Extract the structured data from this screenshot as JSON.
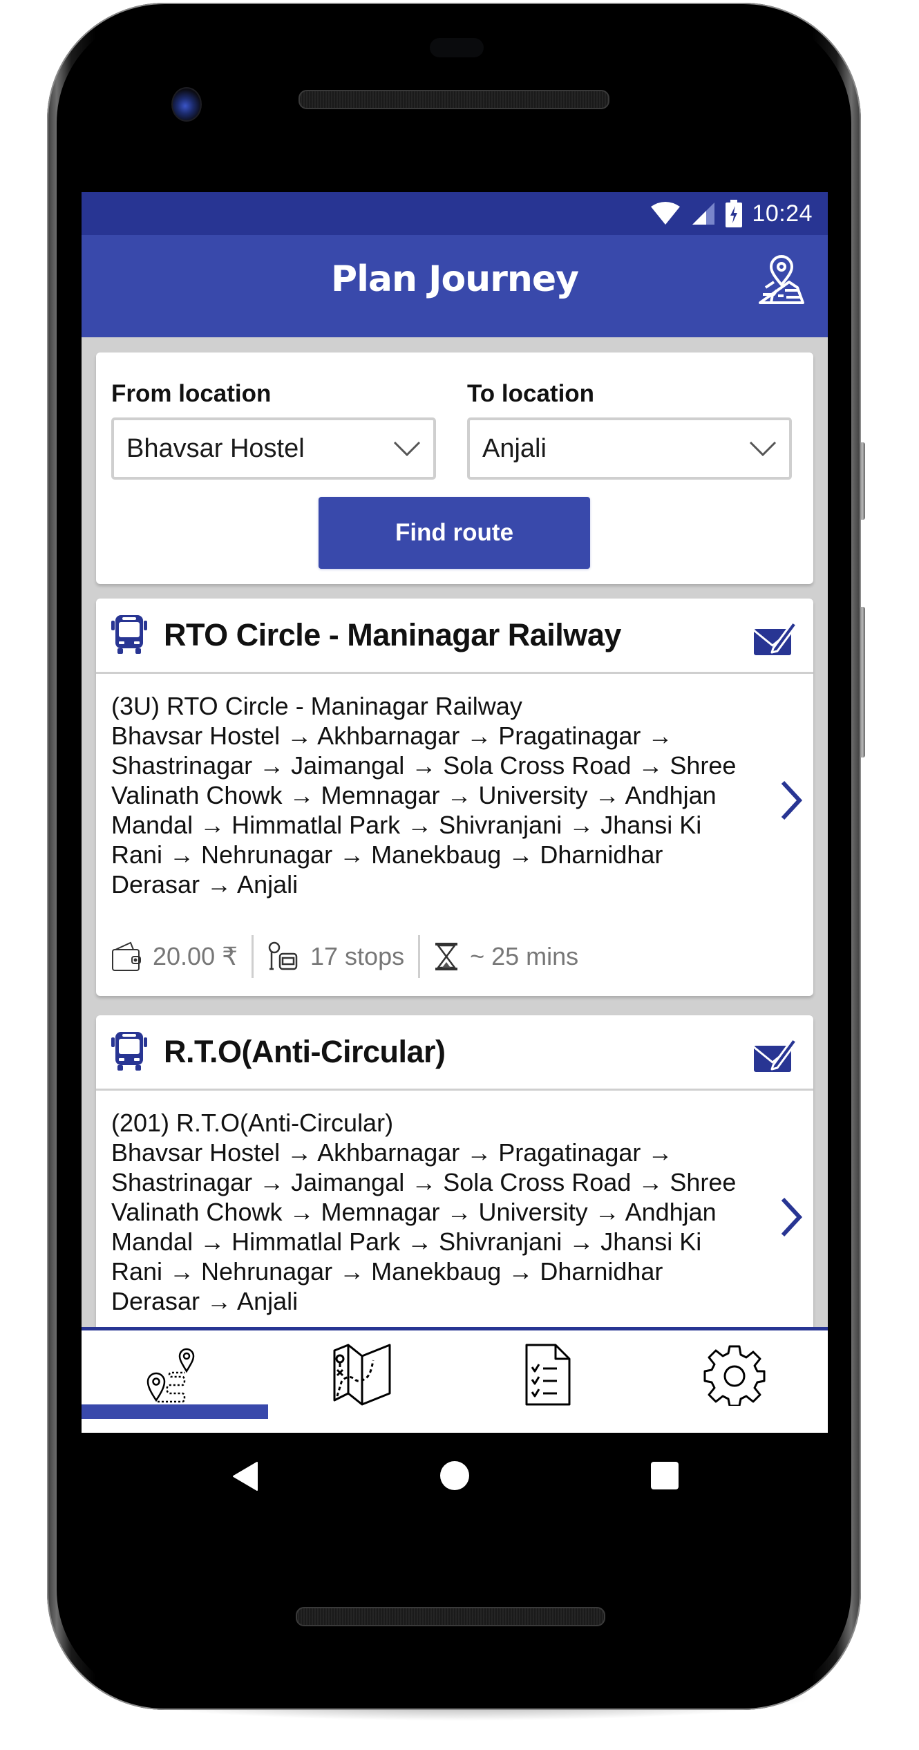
{
  "status_bar": {
    "time": "10:24",
    "icons": [
      "wifi-icon",
      "signal-icon",
      "battery-charging-icon"
    ]
  },
  "app_bar": {
    "title": "Plan Journey",
    "action_icon": "map-pin-icon"
  },
  "form": {
    "from_label": "From location",
    "from_value": "Bhavsar Hostel",
    "to_label": "To location",
    "to_value": "Anjali",
    "find_button": "Find route"
  },
  "routes": [
    {
      "title": "RTO Circle - Maninagar Railway",
      "subtitle": "(3U) RTO Circle - Maninagar Railway",
      "stops_text": "Bhavsar Hostel → Akhbarnagar → Pragatinagar → Shastrinagar → Jaimangal → Sola Cross Road → Shree Valinath Chowk → Memnagar → University → Andhjan Mandal → Himmatlal Park → Shivranjani → Jhansi Ki Rani → Nehrunagar → Manekbaug → Dharnidhar Derasar → Anjali",
      "fare": "20.00 ₹",
      "stops_count": "17 stops",
      "duration": "~ 25 mins"
    },
    {
      "title": "R.T.O(Anti-Circular)",
      "subtitle": "(201) R.T.O(Anti-Circular)",
      "stops_text": "Bhavsar Hostel → Akhbarnagar → Pragatinagar → Shastrinagar → Jaimangal → Sola Cross Road → Shree Valinath Chowk → Memnagar → University → Andhjan Mandal → Himmatlal Park → Shivranjani → Jhansi Ki Rani → Nehrunagar → Manekbaug → Dharnidhar Derasar → Anjali"
    }
  ],
  "bottom_nav": {
    "tabs": [
      {
        "icon": "route-plan-icon",
        "active": true
      },
      {
        "icon": "map-icon",
        "active": false
      },
      {
        "icon": "checklist-icon",
        "active": false
      },
      {
        "icon": "settings-gear-icon",
        "active": false
      }
    ]
  },
  "system_nav": [
    "back",
    "home",
    "recents"
  ],
  "colors": {
    "primary": "#3949ab",
    "primary_dark": "#283593",
    "background": "#d0d0d0"
  }
}
